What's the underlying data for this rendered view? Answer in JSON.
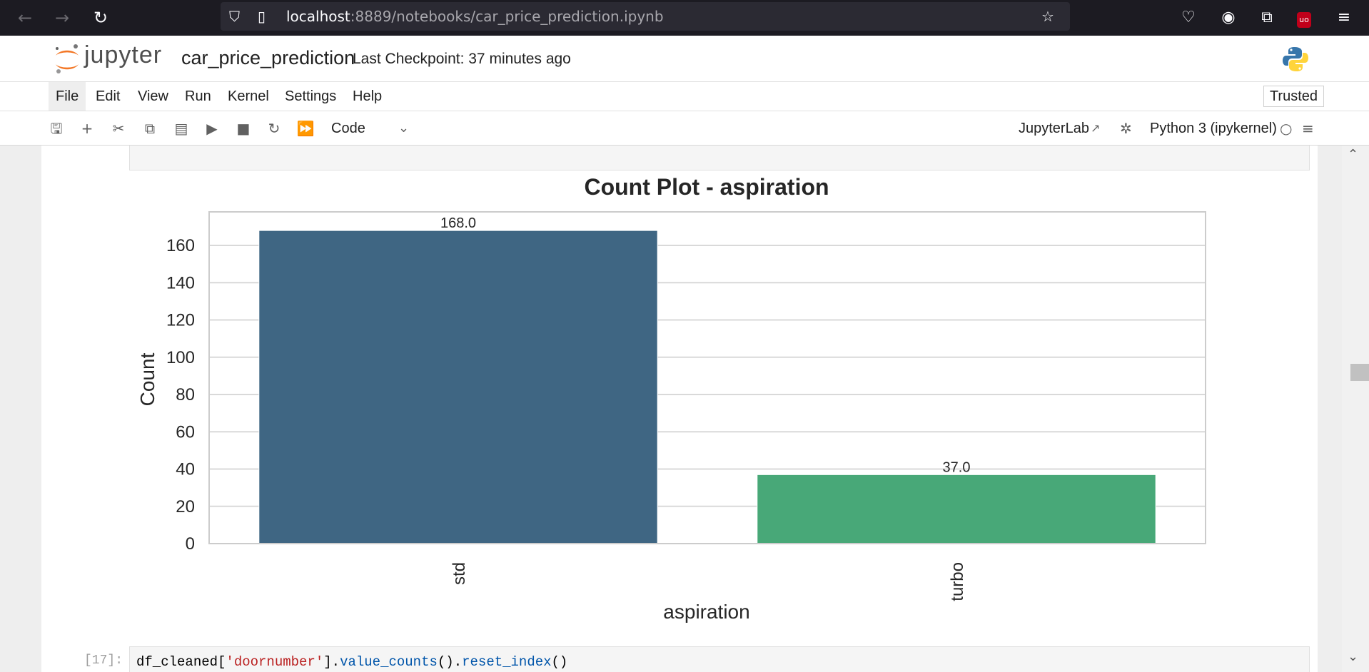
{
  "browser": {
    "url_host": "localhost",
    "url_rest": ":8889/notebooks/car_price_prediction.ipynb"
  },
  "header": {
    "logo_text": "jupyter",
    "notebook_title": "car_price_prediction",
    "checkpoint": "Last Checkpoint: 37 minutes ago"
  },
  "menu": {
    "items": [
      "File",
      "Edit",
      "View",
      "Run",
      "Kernel",
      "Settings",
      "Help"
    ],
    "trusted": "Trusted"
  },
  "toolbar": {
    "cell_type": "Code",
    "jupyterlab": "JupyterLab",
    "kernel": "Python 3 (ipykernel)"
  },
  "cell": {
    "prompt": "[17]:",
    "code_prefix": "df_cleaned[",
    "code_string": "'doornumber'",
    "code_mid": "].",
    "code_fn1": "value_counts",
    "code_mid2": "().",
    "code_fn2": "reset_index",
    "code_end": "()"
  },
  "colors": {
    "bar_std": "#3f6683",
    "bar_turbo": "#48a878"
  },
  "chart_data": {
    "type": "bar",
    "title": "Count Plot - aspiration",
    "xlabel": "aspiration",
    "ylabel": "Count",
    "categories": [
      "std",
      "turbo"
    ],
    "values": [
      168.0,
      37.0
    ],
    "data_labels": [
      "168.0",
      "37.0"
    ],
    "ylim": [
      0,
      178
    ],
    "yticks": [
      0,
      20,
      40,
      60,
      80,
      100,
      120,
      140,
      160
    ],
    "grid": true,
    "legend": "none"
  }
}
